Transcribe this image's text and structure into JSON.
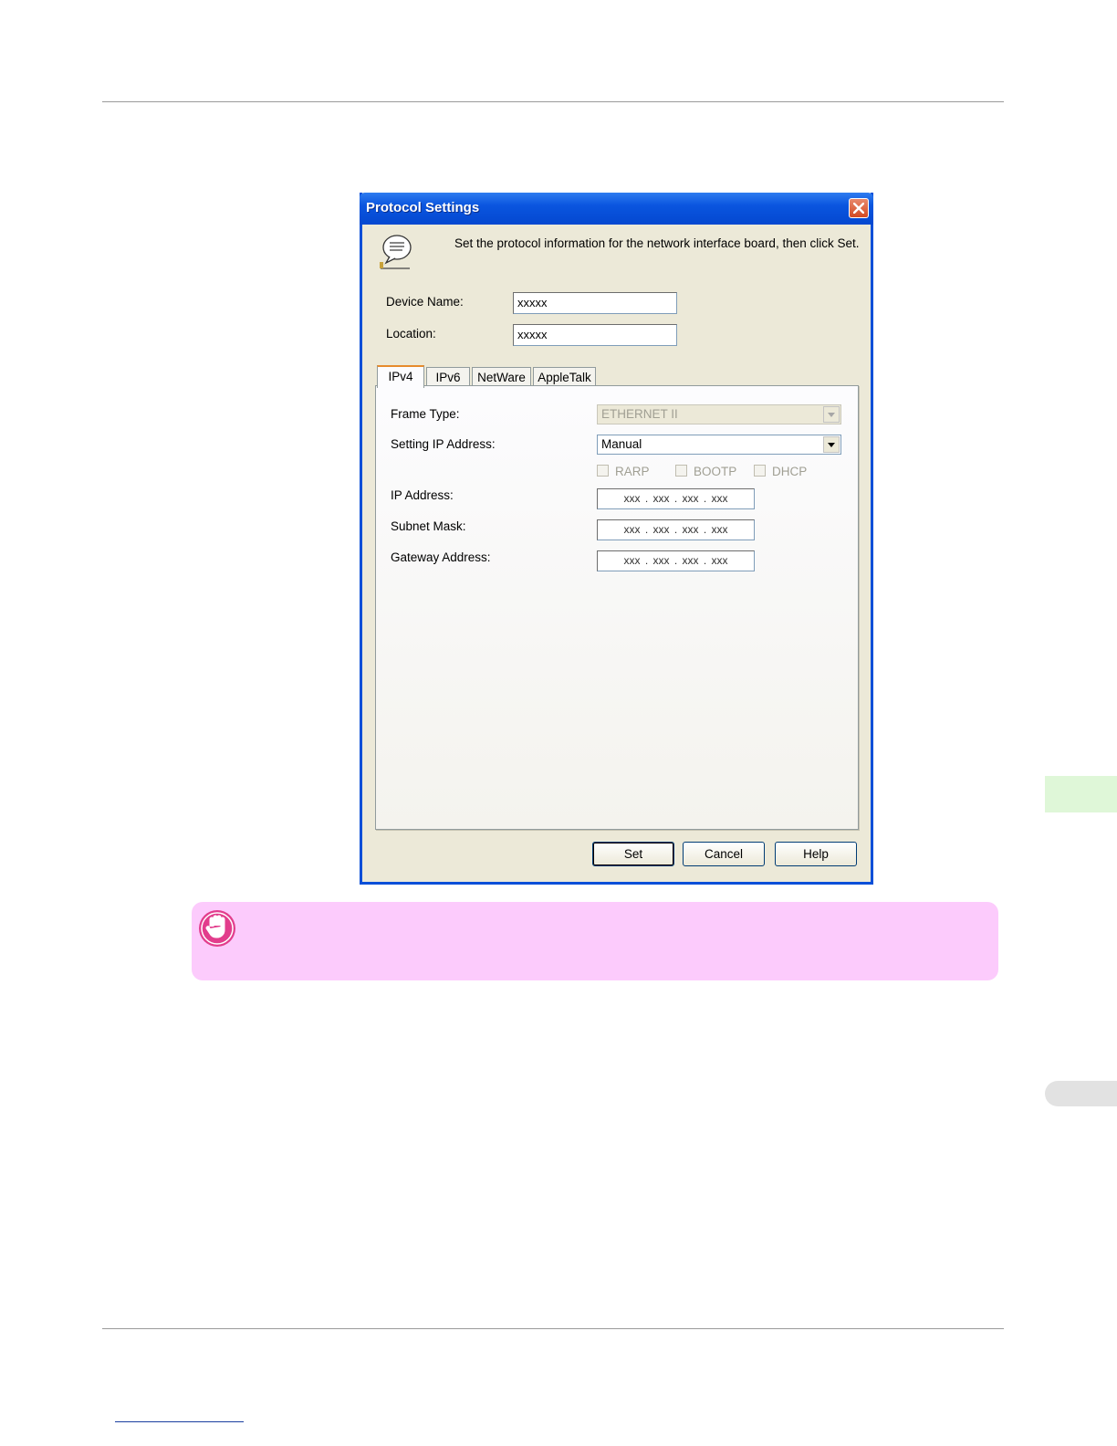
{
  "dialog": {
    "title": "Protocol Settings",
    "instruction": "Set the protocol information for the network interface board, then click Set.",
    "device_name_label": "Device Name:",
    "device_name_value": "xxxxx",
    "location_label": "Location:",
    "location_value": "xxxxx",
    "tabs": [
      {
        "label": "IPv4",
        "active": true
      },
      {
        "label": "IPv6",
        "active": false
      },
      {
        "label": "NetWare",
        "active": false
      },
      {
        "label": "AppleTalk",
        "active": false
      }
    ],
    "ipv4": {
      "frame_type_label": "Frame Type:",
      "frame_type_value": "ETHERNET II",
      "setting_ip_label": "Setting IP Address:",
      "setting_ip_value": "Manual",
      "checkboxes": [
        "RARP",
        "BOOTP",
        "DHCP"
      ],
      "ip_address_label": "IP Address:",
      "ip_address_value": "xxx . xxx . xxx . xxx",
      "subnet_mask_label": "Subnet Mask:",
      "subnet_mask_value": "xxx . xxx . xxx . xxx",
      "gateway_label": "Gateway Address:",
      "gateway_value": "xxx . xxx . xxx . xxx"
    },
    "buttons": {
      "set": "Set",
      "cancel": "Cancel",
      "help": "Help"
    }
  },
  "colors": {
    "titlebar": "#0a55df",
    "dialog_bg": "#ece9d8",
    "important_bg": "#fccbfc",
    "important_icon": "#e23d8c",
    "side_tab": "#dff7d8"
  },
  "icons": [
    "info-speech-icon",
    "close-icon",
    "important-hand-icon",
    "dropdown-arrow-icon"
  ]
}
